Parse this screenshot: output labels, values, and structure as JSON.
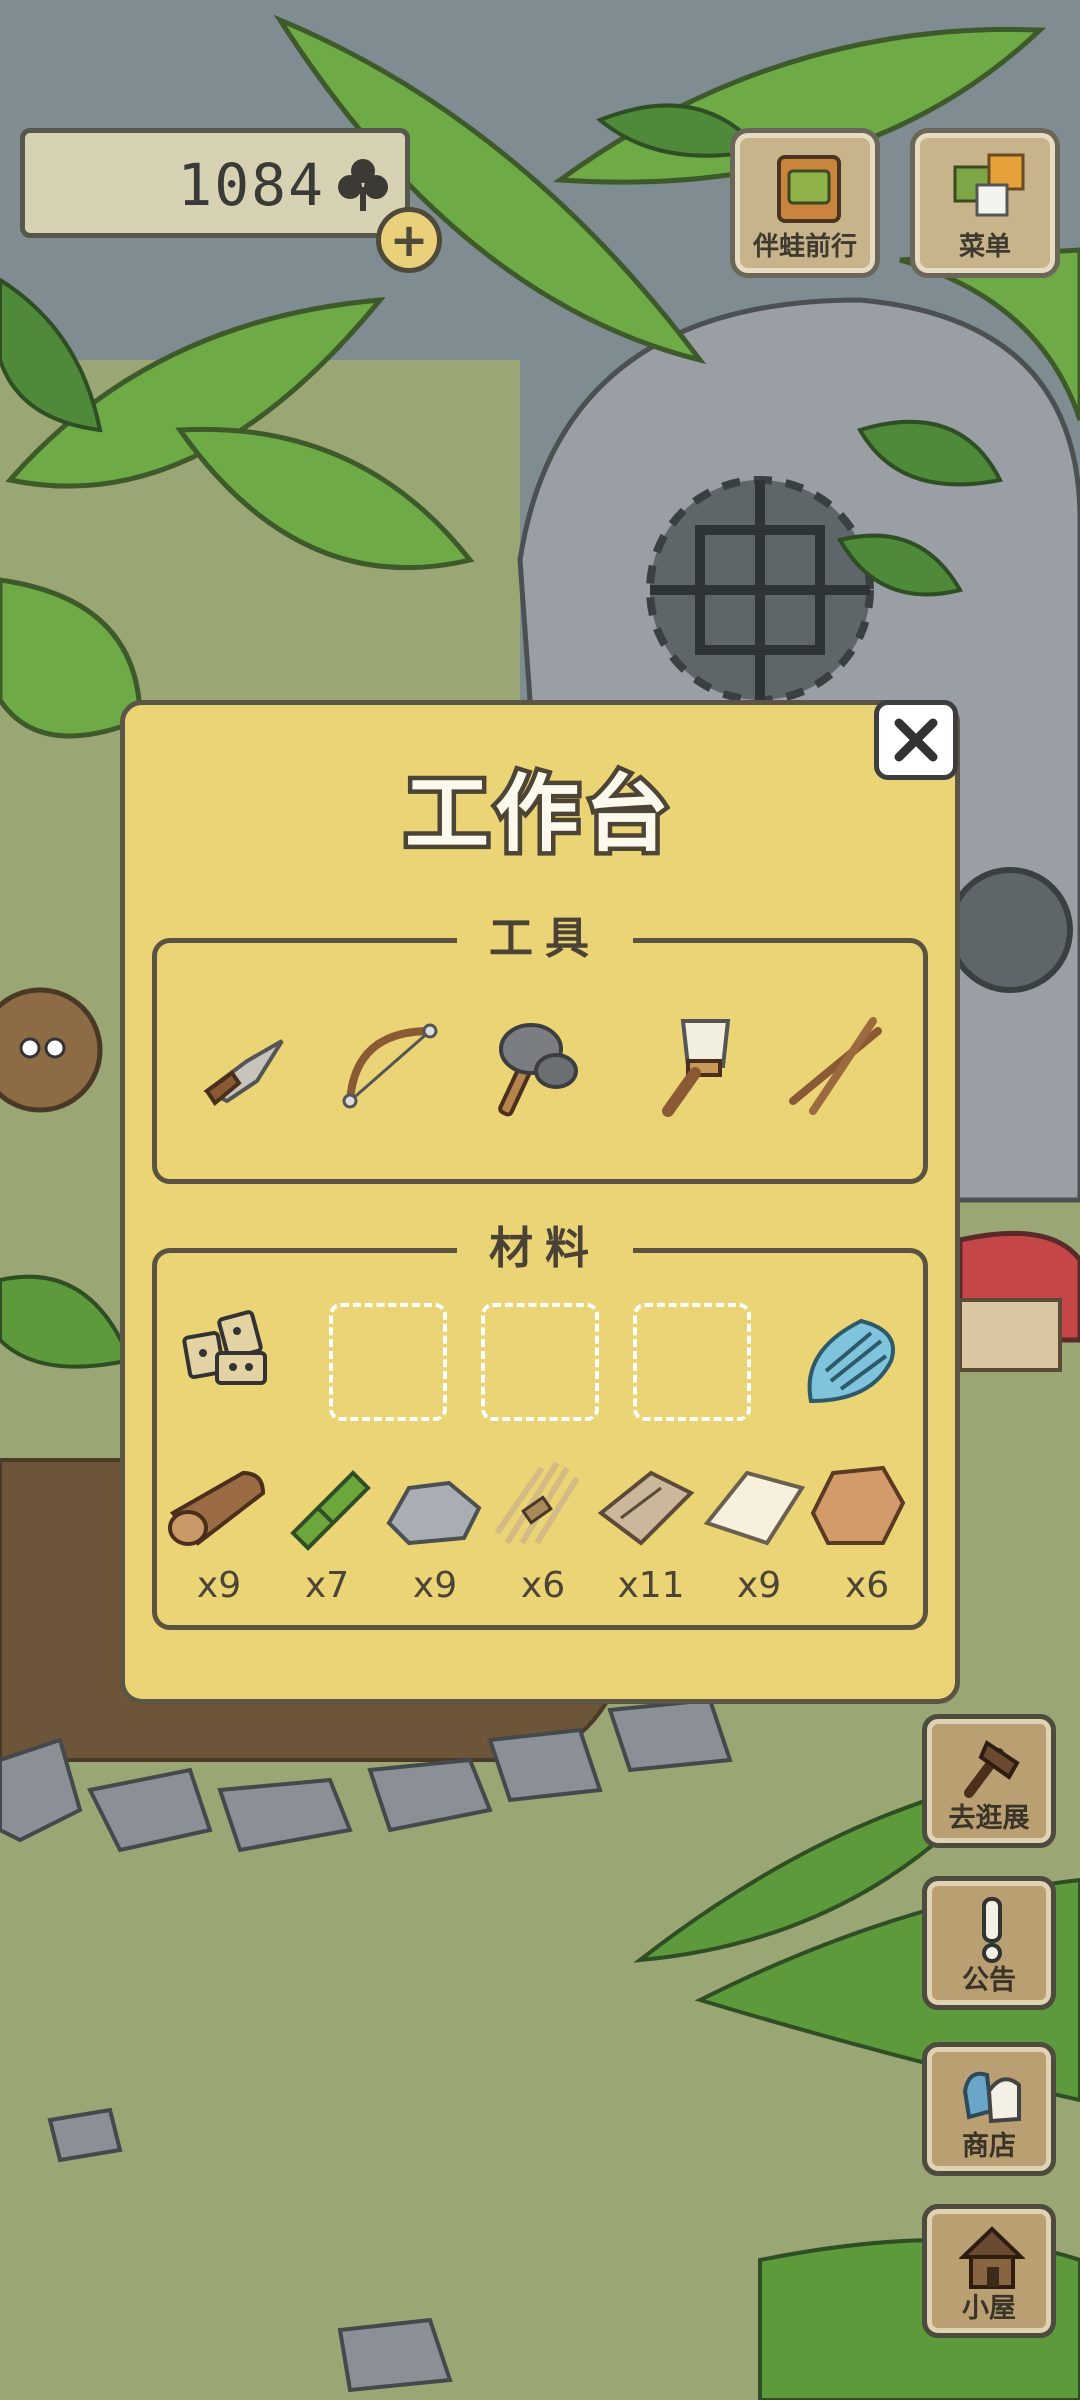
{
  "currency": {
    "clovers": "1084",
    "add_symbol": "+"
  },
  "top_buttons": {
    "travel_with_frog": "伴蛙前行",
    "menu": "菜单"
  },
  "dialog": {
    "title": "工作台",
    "tools_label": "工具",
    "materials_label": "材料",
    "tools": [
      "knife-icon",
      "bow-icon",
      "stone-axe-icon",
      "brush-icon",
      "chopsticks-icon"
    ],
    "material_slots": [
      "dice-charm-icon",
      "empty",
      "empty",
      "empty",
      "seashell-icon"
    ],
    "materials": [
      {
        "icon": "log-icon",
        "count": "x9"
      },
      {
        "icon": "bamboo-icon",
        "count": "x7"
      },
      {
        "icon": "stone-icon",
        "count": "x9"
      },
      {
        "icon": "straw-bundle-icon",
        "count": "x6"
      },
      {
        "icon": "cloth-icon",
        "count": "x11"
      },
      {
        "icon": "paper-icon",
        "count": "x9"
      },
      {
        "icon": "leather-icon",
        "count": "x6"
      }
    ]
  },
  "side_buttons": {
    "exhibition": "去逛展",
    "notice": "公告",
    "shop": "商店",
    "house": "小屋"
  }
}
